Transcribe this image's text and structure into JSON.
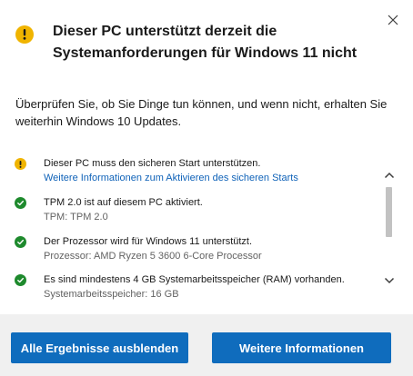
{
  "dialog": {
    "title": "Dieser PC unterstützt derzeit die Systemanforderungen für Windows 11 nicht",
    "intro": "Überprüfen Sie, ob Sie Dinge tun können, und wenn nicht, erhalten Sie weiterhin Windows 10 Updates.",
    "title_icon": "warning-icon",
    "close_icon": "close-icon",
    "colors": {
      "warning": "#f0b400",
      "success": "#1e8a2d",
      "link": "#0f62b8",
      "button": "#0f6cbd",
      "footer_bg": "#f0f0f0"
    }
  },
  "results": [
    {
      "status": "warning",
      "icon": "warning-icon",
      "text": "Dieser PC muss den sicheren Start unterstützen.",
      "detail": "Weitere Informationen zum Aktivieren des sicheren Starts",
      "detail_is_link": true
    },
    {
      "status": "ok",
      "icon": "check-icon",
      "text": "TPM 2.0 ist auf diesem PC aktiviert.",
      "detail": "TPM: TPM 2.0",
      "detail_is_link": false
    },
    {
      "status": "ok",
      "icon": "check-icon",
      "text": "Der Prozessor wird für Windows 11 unterstützt.",
      "detail": "Prozessor: AMD Ryzen 5 3600 6-Core Processor",
      "detail_is_link": false
    },
    {
      "status": "ok",
      "icon": "check-icon",
      "text": "Es sind mindestens 4 GB Systemarbeitsspeicher (RAM) vorhanden.",
      "detail": "Systemarbeitsspeicher: 16 GB",
      "detail_is_link": false
    }
  ],
  "footer": {
    "hide_button": "Alle Ergebnisse ausblenden",
    "more_info_button": "Weitere Informationen"
  }
}
